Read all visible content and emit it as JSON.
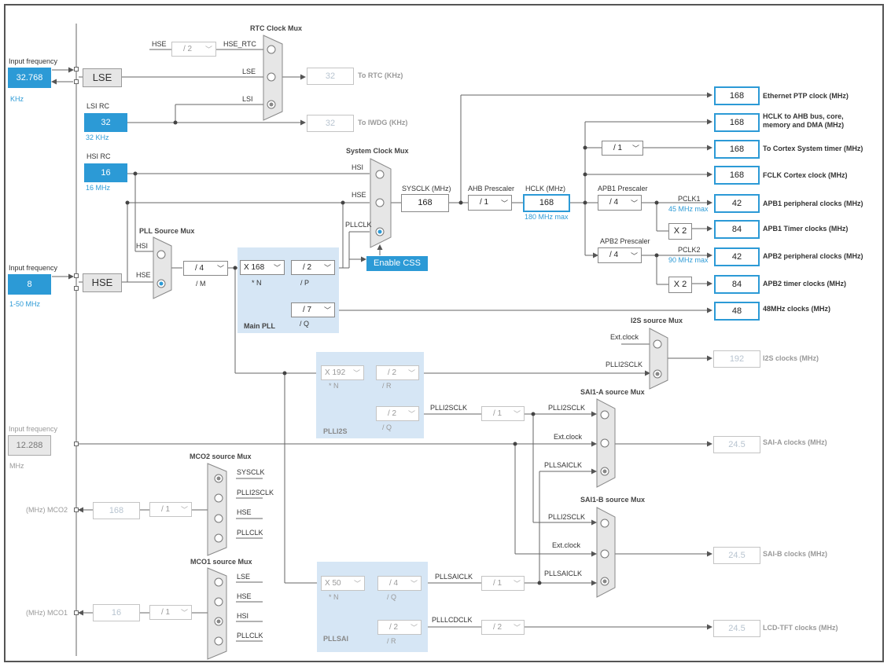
{
  "left_inputs": {
    "lse_input": {
      "label": "Input frequency",
      "value": "32.768",
      "unit": "KHz"
    },
    "hse_input": {
      "label": "Input frequency",
      "value": "8",
      "range": "1-50 MHz"
    },
    "ext_input": {
      "label": "Input frequency",
      "value": "12.288",
      "unit": "MHz"
    }
  },
  "oscillators": {
    "lse": "LSE",
    "hse": "HSE",
    "lsi_rc": {
      "title": "LSI RC",
      "value": "32",
      "freq": "32 KHz"
    },
    "hsi_rc": {
      "title": "HSI RC",
      "value": "16",
      "freq": "16 MHz"
    }
  },
  "rtc": {
    "mux_title": "RTC Clock Mux",
    "hse_in": "HSE",
    "div": "/ 2",
    "hse_rtc": "HSE_RTC",
    "lse": "LSE",
    "lsi": "LSI",
    "rtc_value": "32",
    "rtc_label": "To RTC (KHz)",
    "iwdg_value": "32",
    "iwdg_label": "To IWDG (KHz)"
  },
  "sysclk_mux": {
    "title": "System Clock Mux",
    "hsi": "HSI",
    "hse": "HSE",
    "pllclk": "PLLCLK",
    "enable_css": "Enable CSS"
  },
  "sysclk": {
    "label": "SYSCLK (MHz)",
    "value": "168"
  },
  "ahb": {
    "label": "AHB Prescaler",
    "value": "/ 1"
  },
  "hclk": {
    "label": "HCLK (MHz)",
    "value": "168",
    "max": "180 MHz max"
  },
  "apb1": {
    "label": "APB1 Prescaler",
    "value": "/ 4",
    "pclk": "PCLK1",
    "max": "45 MHz max"
  },
  "apb2": {
    "label": "APB2 Prescaler",
    "value": "/ 4",
    "pclk": "PCLK2",
    "max": "90 MHz max"
  },
  "cortex_div": "/ 1",
  "x2_a": "X 2",
  "x2_b": "X 2",
  "outputs": [
    {
      "value": "168",
      "label": "Ethernet PTP clock (MHz)"
    },
    {
      "value": "168",
      "label": "HCLK to AHB bus, core,",
      "label2": "memory and DMA (MHz)"
    },
    {
      "value": "168",
      "label": "To Cortex System timer (MHz)"
    },
    {
      "value": "168",
      "label": "FCLK Cortex clock (MHz)"
    },
    {
      "value": "42",
      "label": "APB1 peripheral clocks (MHz)"
    },
    {
      "value": "84",
      "label": "APB1 Timer clocks (MHz)"
    },
    {
      "value": "42",
      "label": "APB2 peripheral clocks (MHz)"
    },
    {
      "value": "84",
      "label": "APB2 timer clocks (MHz)"
    },
    {
      "value": "48",
      "label": "48MHz clocks (MHz)"
    }
  ],
  "pll_source_mux": {
    "title": "PLL Source Mux",
    "hsi": "HSI",
    "hse": "HSE",
    "m_value": "/ 4",
    "m_label": "/ M"
  },
  "main_pll": {
    "title": "Main PLL",
    "n_value": "X 168",
    "n_label": "* N",
    "p_value": "/ 2",
    "p_label": "/ P",
    "q_value": "/ 7",
    "q_label": "/ Q"
  },
  "i2s": {
    "mux_title": "I2S source Mux",
    "ext_clock": "Ext.clock",
    "plli2sclk": "PLLI2SCLK",
    "value": "192",
    "label": "I2S clocks (MHz)"
  },
  "plli2s": {
    "title": "PLLI2S",
    "n_value": "X 192",
    "n_label": "* N",
    "r_value": "/ 2",
    "r_label": "/ R",
    "q_value": "/ 2",
    "q_label": "/ Q",
    "out": "PLLI2SCLK",
    "div": "/ 1"
  },
  "sai_a": {
    "mux_title": "SAI1-A source Mux",
    "in1": "PLLI2SCLK",
    "in2": "Ext.clock",
    "in3": "PLLSAICLK",
    "value": "24.5",
    "label": "SAI-A clocks (MHz)"
  },
  "sai_b": {
    "mux_title": "SAI1-B source Mux",
    "in1": "PLLI2SCLK",
    "in2": "Ext.clock",
    "in3": "PLLSAICLK",
    "value": "24.5",
    "label": "SAI-B clocks (MHz)"
  },
  "pllsai": {
    "title": "PLLSAI",
    "n_value": "X 50",
    "n_label": "* N",
    "q_value": "/ 4",
    "q_label": "/ Q",
    "r_value": "/ 2",
    "r_label": "/ R",
    "q_out": "PLLSAICLK",
    "q_div": "/ 1",
    "r_out": "PLLLCDCLK",
    "r_div": "/ 2"
  },
  "lcd": {
    "value": "24.5",
    "label": "LCD-TFT clocks (MHz)"
  },
  "mco2": {
    "mux_title": "MCO2 source Mux",
    "in": [
      "SYSCLK",
      "PLLI2SCLK",
      "HSE",
      "PLLCLK"
    ],
    "div": "/ 1",
    "value": "168",
    "label": "(MHz) MCO2"
  },
  "mco1": {
    "mux_title": "MCO1 source Mux",
    "in": [
      "LSE",
      "HSE",
      "HSI",
      "PLLCLK"
    ],
    "div": "/ 1",
    "value": "16",
    "label": "(MHz) MCO1"
  },
  "colors": {
    "accent": "#2c9ad6",
    "pll_box": "#d6e6f5",
    "mux_fill": "#e6e6e6",
    "wire": "#666666"
  }
}
